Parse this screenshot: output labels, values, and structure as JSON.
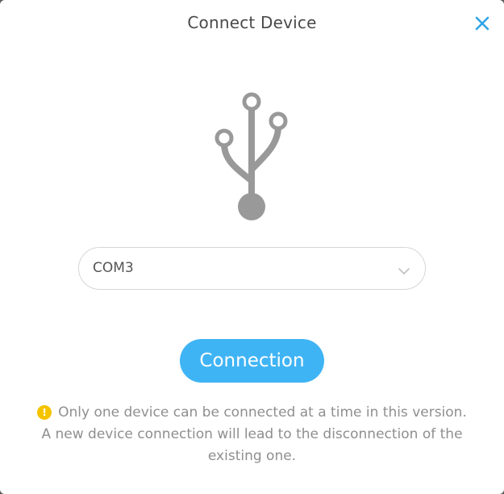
{
  "dialog": {
    "title": "Connect Device",
    "close_icon": "close-icon",
    "usb_icon": "usb-icon"
  },
  "port_select": {
    "value": "COM3",
    "icon": "chevron-down-icon"
  },
  "connect_button": {
    "label": "Connection"
  },
  "notice": {
    "icon": "warning-icon",
    "icon_glyph": "!",
    "line1": "Only one device can be connected at a time in this version.",
    "line2": "A new device connection will lead to the disconnection of the existing one."
  },
  "colors": {
    "accent": "#3fb4f5",
    "warning": "#f5c400",
    "icon_gray": "#999999"
  }
}
